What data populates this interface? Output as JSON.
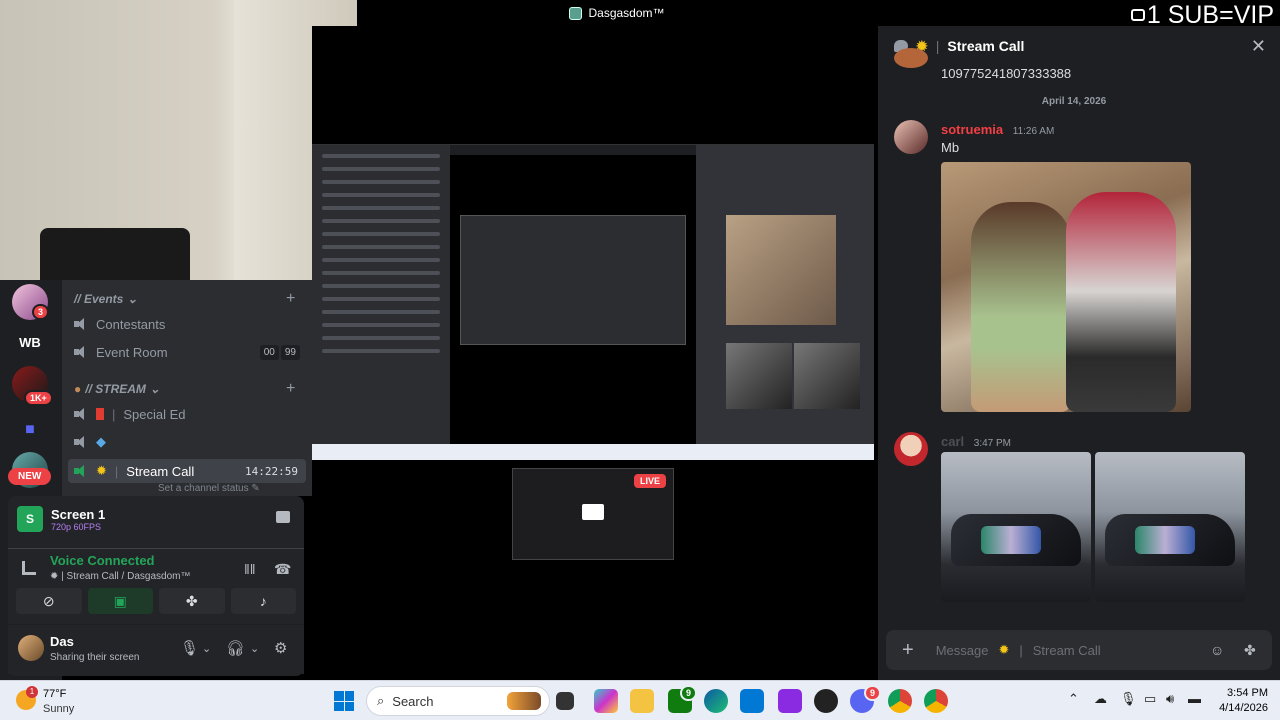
{
  "window": {
    "title": "Dasgasdom™"
  },
  "overlay": {
    "sub_text": "1 SUB=VIP"
  },
  "stream": {
    "live_label": "LIVE"
  },
  "servers": [
    {
      "badge": "3"
    },
    {
      "label": "WB"
    },
    {
      "badge": "1K+"
    },
    {
      "label": ""
    },
    {
      "new_label": "NEW"
    }
  ],
  "channels": {
    "cat_events": "// Events",
    "contestants": "Contestants",
    "event_room": "Event Room",
    "event_counter": [
      "00",
      "99"
    ],
    "cat_stream": "// STREAM",
    "special_ed": "Special Ed",
    "stream_call": "Stream Call",
    "stream_call_timer": "14:22:59",
    "set_status": "Set a channel status"
  },
  "screen_share": {
    "title": "Screen 1",
    "quality": "720p 60FPS"
  },
  "voice": {
    "status": "Voice Connected",
    "location": "Stream Call / Dasgasdom™"
  },
  "user": {
    "name": "Das",
    "status": "Sharing their screen"
  },
  "chat": {
    "channel": "Stream Call",
    "prev_message": "109775241807333388",
    "date_divider": "April 14, 2026",
    "messages": [
      {
        "author": "sotruemia",
        "time": "11:26 AM",
        "text": "Mb",
        "author_color": "#f23f43"
      },
      {
        "author": "carl",
        "time": "3:47 PM",
        "author_color": "#4e5058"
      }
    ],
    "composer_placeholder": "Message",
    "composer_channel": "Stream Call"
  },
  "taskbar": {
    "temp": "77°F",
    "condition": "Sunny",
    "weather_badge": "1",
    "search_label": "Search",
    "discord_badge": "9",
    "xbox_badge": "9",
    "time": "3:54 PM",
    "date": "4/14/2026"
  },
  "colors": {
    "discord_green": "#23a559",
    "discord_red": "#ed4245",
    "accent_blue": "#0078d4"
  }
}
